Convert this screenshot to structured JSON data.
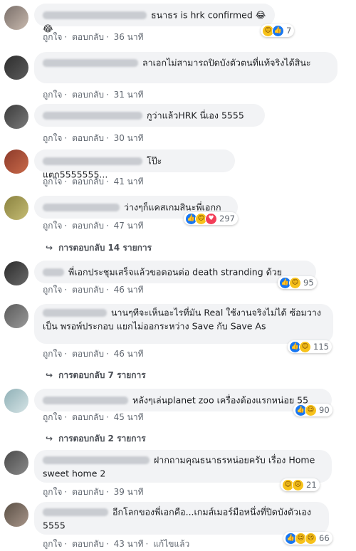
{
  "comments": [
    {
      "text": "ธนาธร is hrk confirmed 😂😂",
      "like": "ถูกใจ",
      "reply": "ตอบกลับ",
      "time": "36 นาที",
      "reactions": [
        "like",
        "haha"
      ],
      "count": "7"
    },
    {
      "text": "ลาเอกไม่สามารถปิดบังตัวตนที่แท้จริงได้สินะ",
      "like": "ถูกใจ",
      "reply": "ตอบกลับ",
      "time": "31 นาที"
    },
    {
      "text": "กูว่าแล้วHRK นี่เอง 5555",
      "like": "ถูกใจ",
      "reply": "ตอบกลับ",
      "time": "30 นาที"
    },
    {
      "text": "โป๊ะแตก5555555...",
      "like": "ถูกใจ",
      "reply": "ตอบกลับ",
      "time": "41 นาที"
    },
    {
      "text": "ว่างๆก็แคสเกมสินะพี่เอกก",
      "like": "ถูกใจ",
      "reply": "ตอบกลับ",
      "time": "47 นาที",
      "reactions": [
        "like",
        "haha",
        "love"
      ],
      "count": "297",
      "replies": "การตอบกลับ 14 รายการ"
    },
    {
      "text": "พี่เอกประชุมเสร็จแล้วขอตอนต่อ death stranding ด้วย",
      "like": "ถูกใจ",
      "reply": "ตอบกลับ",
      "time": "46 นาที",
      "reactions": [
        "like",
        "haha"
      ],
      "count": "95"
    },
    {
      "text": "นานๆทีจะเห็นอะไรที่มัน Real ใช้งานจริงไม่ได้ ซ้อมวางเป็น พรอพ์ประกอบ แยกไม่ออกระหว่าง Save กับ Save As",
      "like": "ถูกใจ",
      "reply": "ตอบกลับ",
      "time": "46 นาที",
      "reactions": [
        "like",
        "haha"
      ],
      "count": "115",
      "replies": "การตอบกลับ 7 รายการ"
    },
    {
      "text": "หลังๆเล่นplanet zoo เครื่องต้องแรกหน่อย 55",
      "like": "ถูกใจ",
      "reply": "ตอบกลับ",
      "time": "45 นาที",
      "reactions": [
        "like",
        "haha"
      ],
      "count": "90",
      "replies": "การตอบกลับ 2 รายการ"
    },
    {
      "text": "ฝากถามคุณธนาธรหน่อยครับ เรื่อง Home sweet home 2",
      "like": "ถูกใจ",
      "reply": "ตอบกลับ",
      "time": "39 นาที",
      "reactions": [
        "haha",
        "sad"
      ],
      "count": "21"
    },
    {
      "text": "อีกโลกของพี่เอกคือ...เกมส์เมอร์มือหนึ่งที่ปิดบังตัวเอง 5555",
      "like": "ถูกใจ",
      "reply": "ตอบกลับ",
      "time": "43 นาที",
      "edited": "แก้ไขแล้ว",
      "reactions": [
        "like",
        "haha",
        "sad"
      ],
      "count": "66"
    }
  ],
  "colors": {
    "like": "#1877f2",
    "haha": "#f7c21b",
    "love": "#f33e58",
    "bubble": "#f2f3f5",
    "meta": "#606770"
  }
}
